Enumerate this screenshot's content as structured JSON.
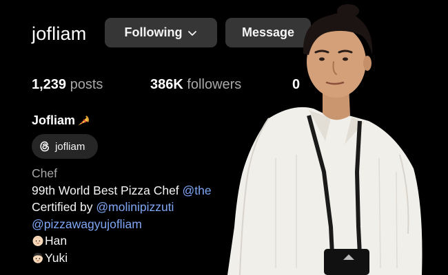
{
  "profile": {
    "username": "jofliam",
    "display_name": "Jofliam",
    "display_name_emoji": "pizza-emoji"
  },
  "actions": {
    "following_label": "Following",
    "message_label": "Message"
  },
  "stats": {
    "posts_count": "1,239",
    "posts_label": "posts",
    "followers_count": "386K",
    "followers_label": "followers",
    "following_count": "0"
  },
  "threads_badge": {
    "icon": "threads-icon",
    "handle": "jofliam"
  },
  "bio": {
    "category": "Chef",
    "line1_text": "99th World Best Pizza Chef ",
    "line1_mention": "@the",
    "line2_text": "Certified by ",
    "line2_mention": "@molinipizzuti",
    "line3_mention": "@pizzawagyujofliam",
    "line4_text": "Han",
    "line5_text": "Yuki"
  },
  "colors": {
    "background": "#000000",
    "button_bg": "#363636",
    "pill_bg": "#262626",
    "link": "#7fa7f5",
    "muted": "#a8a8a8"
  }
}
